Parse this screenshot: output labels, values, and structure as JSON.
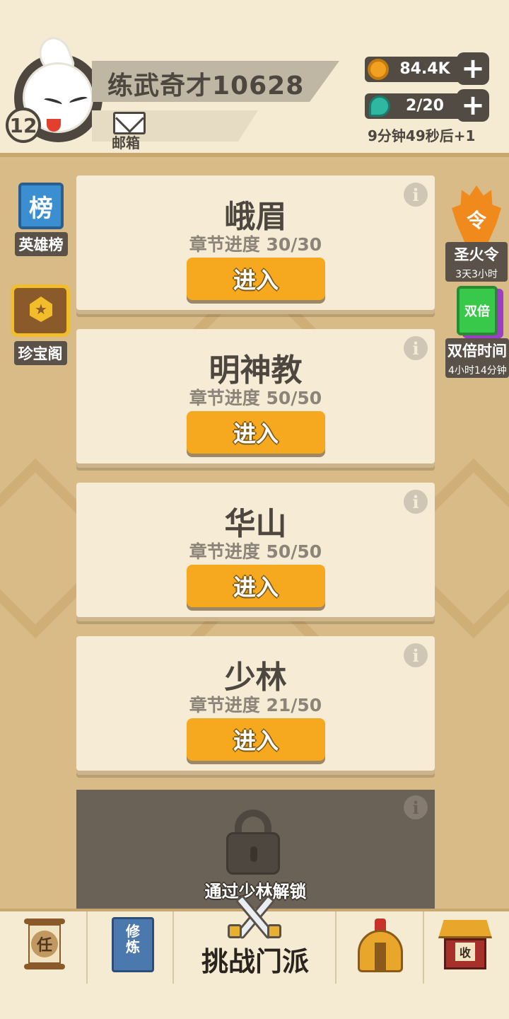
{
  "player": {
    "name": "练武奇才10628",
    "level": "12",
    "mail_label": "邮箱"
  },
  "resources": {
    "coins": "84.4K",
    "energy": "2/20",
    "energy_timer": "9分钟49秒后+1",
    "plus": "+"
  },
  "left_side": {
    "leaderboard_icon_text": "榜",
    "leaderboard_label": "英雄榜",
    "treasure_label": "珍宝阁"
  },
  "right_side": {
    "holy_fire_icon_text": "令",
    "holy_fire_label": "圣火令",
    "holy_fire_time": "3天3小时",
    "double_icon_text": "双倍",
    "double_label": "双倍时间",
    "double_time": "4小时14分钟"
  },
  "sects": [
    {
      "name": "峨眉",
      "progress": "章节进度 30/30",
      "button": "进入"
    },
    {
      "name": "明神教",
      "progress": "章节进度 50/50",
      "button": "进入"
    },
    {
      "name": "华山",
      "progress": "章节进度 50/50",
      "button": "进入"
    },
    {
      "name": "少林",
      "progress": "章节进度 21/50",
      "button": "进入"
    }
  ],
  "locked": {
    "text": "通过少林解锁"
  },
  "info_glyph": "i",
  "nav": {
    "task_icon_text": "任",
    "cultivate_icon_line1": "修",
    "cultivate_icon_line2": "炼",
    "center_label": "挑战门派",
    "collect_icon_text": "收"
  },
  "colors": {
    "accent_orange": "#f6a91f",
    "panel_cream": "#f6ebd4",
    "background_tan": "#d9bd8a",
    "dark_brown": "#4d4740"
  }
}
